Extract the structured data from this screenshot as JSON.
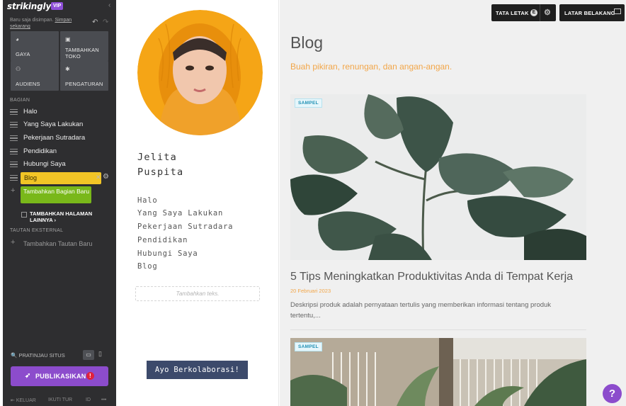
{
  "editor": {
    "brand": "strikingly",
    "vip_badge": "VIP",
    "saved_note": "Baru saja disimpan.",
    "save_now": "Simpan sekarang",
    "tiles": [
      {
        "label": "GAYA",
        "icon": "palette-icon"
      },
      {
        "label": "TAMBAHKAN TOKO",
        "icon": "store-icon"
      },
      {
        "label": "AUDIENS",
        "icon": "audience-icon"
      },
      {
        "label": "PENGATURAN",
        "icon": "gear-icon"
      }
    ],
    "sections_heading": "BAGIAN",
    "sections": [
      {
        "label": "Halo"
      },
      {
        "label": "Yang Saya Lakukan"
      },
      {
        "label": "Pekerjaan Sutradara"
      },
      {
        "label": "Pendidikan"
      },
      {
        "label": "Hubungi Saya"
      },
      {
        "label": "Blog",
        "active": true
      }
    ],
    "add_section": "Tambahkan Bagian Baru",
    "add_page": "TAMBAHKAN HALAMAN LAINNYA",
    "external_heading": "TAUTAN EKSTERNAL",
    "add_external": "Tambahkan Tautan Baru",
    "preview": "PRATINJAU SITUS",
    "publish": "PUBLIKASIKAN",
    "footer": [
      "KELUAR",
      "IKUTI TUR",
      "ID",
      "•••"
    ]
  },
  "site": {
    "name_line1": "Jelita",
    "name_line2": "Puspita",
    "nav": [
      "Halo",
      "Yang Saya Lakukan",
      "Pekerjaan Sutradara",
      "Pendidikan",
      "Hubungi Saya",
      "Blog"
    ],
    "text_placeholder": "Tambahkan teks.",
    "cta": "Ayo Berkolaborasi!"
  },
  "toolbar": {
    "layout": "TATA LETAK",
    "layout_badge": "E",
    "background": "LATAR BELAKANG"
  },
  "blog": {
    "title": "Blog",
    "subtitle": "Buah pikiran, renungan, dan angan-angan.",
    "posts": [
      {
        "badge": "SAMPEL",
        "title": "5 Tips Meningkatkan Produktivitas Anda di Tempat Kerja",
        "date": "20 Februari 2023",
        "description": "Deskripsi produk adalah pernyataan tertulis yang memberikan informasi tentang produk tertentu,..."
      },
      {
        "badge": "SAMPEL"
      }
    ]
  },
  "help": "?",
  "colors": {
    "panel": "#2e2e30",
    "accent_purple": "#8c4ccc",
    "active_yellow": "#f2c526",
    "add_green": "#79b81a",
    "blog_orange": "#f2a648",
    "cta_navy": "#3c4a6b"
  }
}
